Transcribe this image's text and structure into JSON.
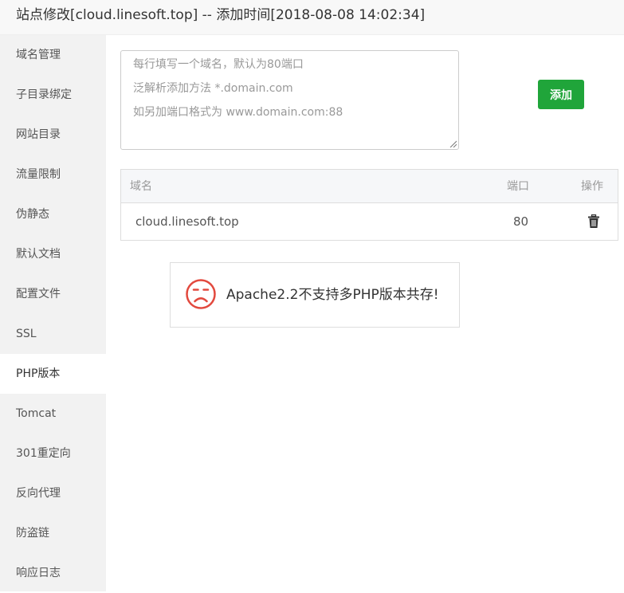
{
  "window": {
    "title": "站点修改[cloud.linesoft.top] -- 添加时间[2018-08-08 14:02:34]"
  },
  "sidebar": {
    "items": [
      {
        "label": "域名管理"
      },
      {
        "label": "子目录绑定"
      },
      {
        "label": "网站目录"
      },
      {
        "label": "流量限制"
      },
      {
        "label": "伪静态"
      },
      {
        "label": "默认文档"
      },
      {
        "label": "配置文件"
      },
      {
        "label": "SSL"
      },
      {
        "label": "PHP版本",
        "active": true
      },
      {
        "label": "Tomcat"
      },
      {
        "label": "301重定向"
      },
      {
        "label": "反向代理"
      },
      {
        "label": "防盗链"
      },
      {
        "label": "响应日志"
      }
    ]
  },
  "domain_input": {
    "value": "",
    "placeholder_lines": [
      "每行填写一个域名，默认为80端口",
      "泛解析添加方法 *.domain.com",
      "如另加端口格式为 www.domain.com:88"
    ]
  },
  "add_button": {
    "label": "添加"
  },
  "domain_table": {
    "columns": [
      "域名",
      "端口",
      "操作"
    ],
    "rows": [
      {
        "domain": "cloud.linesoft.top",
        "port": "80",
        "action_icon": "trash-icon"
      }
    ]
  },
  "notice": {
    "icon": "sad-face-icon",
    "message": "Apache2.2不支持多PHP版本共存!",
    "color": "#e2493e"
  },
  "colors": {
    "accent": "#20a53a",
    "sidebar_bg": "#f2f2f2",
    "titlebar_bg": "#f8f8f8"
  }
}
